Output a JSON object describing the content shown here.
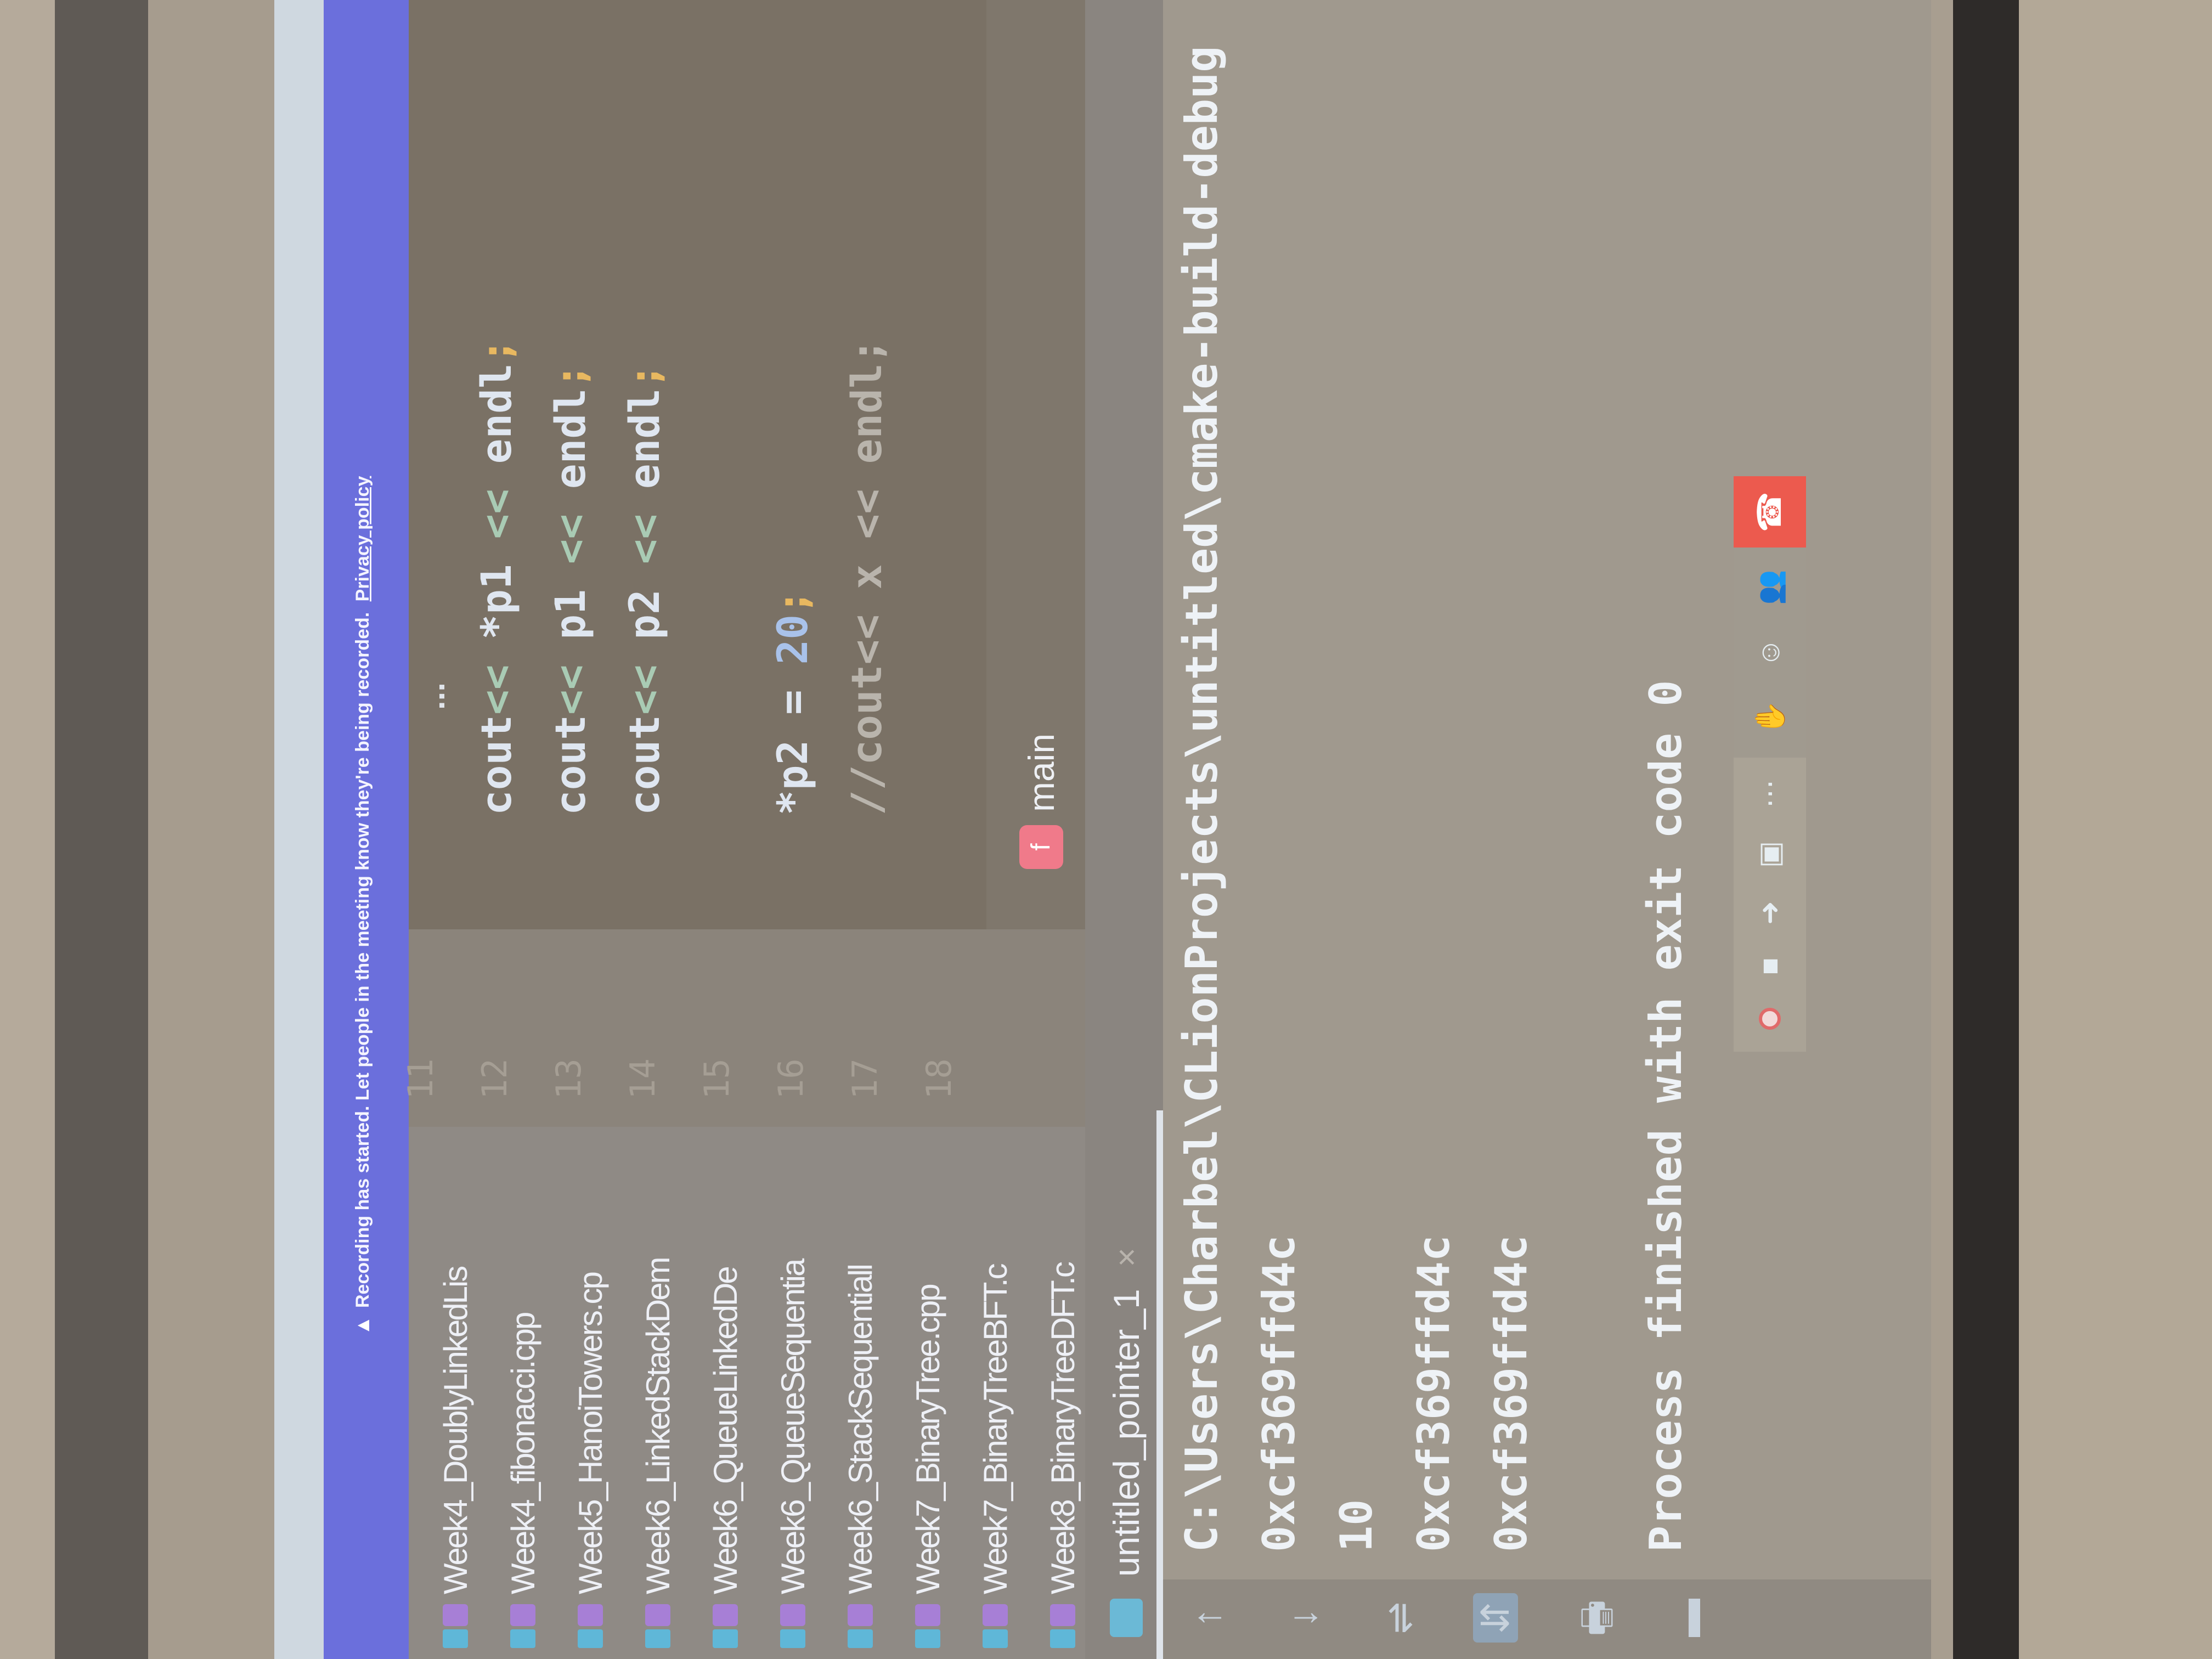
{
  "banner": {
    "icon": "warning-icon",
    "text": "Recording has started. Let people in the meeting know they're being recorded.",
    "link": "Privacy policy"
  },
  "project_files": [
    "Week4_DoublyLinkedLis",
    "Week4_fibonacci.cpp",
    "Week5_HanoiTowers.cp",
    "Week6_LinkedStackDem",
    "Week6_QueueLinkedDe",
    "Week6_QueueSequentia",
    "Week6_StackSequentiall",
    "Week7_BinaryTree.cpp",
    "Week7_BinaryTreeBFT.c",
    "Week8_BinaryTreeDFT.c"
  ],
  "editor": {
    "fold_marker": "...",
    "line_numbers": [
      "11",
      "12",
      "13",
      "14",
      "15",
      "16",
      "17",
      "18"
    ],
    "lines": [
      [],
      [
        {
          "t": "cout",
          "c": "#dfe6f0"
        },
        {
          "t": "<< ",
          "c": "#a9cbb4"
        },
        {
          "t": "*p1 ",
          "c": "#dfe6f0"
        },
        {
          "t": "<< ",
          "c": "#a9cbb4"
        },
        {
          "t": "endl",
          "c": "#dfe6f0"
        },
        {
          "t": ";",
          "c": "#e8b860"
        }
      ],
      [
        {
          "t": "cout",
          "c": "#dfe6f0"
        },
        {
          "t": "<< ",
          "c": "#a9cbb4"
        },
        {
          "t": "p1 ",
          "c": "#dfe6f0"
        },
        {
          "t": "<< ",
          "c": "#a9cbb4"
        },
        {
          "t": "endl",
          "c": "#dfe6f0"
        },
        {
          "t": ";",
          "c": "#e8b860"
        }
      ],
      [
        {
          "t": "cout",
          "c": "#dfe6f0"
        },
        {
          "t": "<< ",
          "c": "#a9cbb4"
        },
        {
          "t": "p2 ",
          "c": "#dfe6f0"
        },
        {
          "t": "<< ",
          "c": "#a9cbb4"
        },
        {
          "t": "endl",
          "c": "#dfe6f0"
        },
        {
          "t": ";",
          "c": "#e8b860"
        }
      ],
      [],
      [
        {
          "t": "*p2 = ",
          "c": "#dfe6f0"
        },
        {
          "t": "20",
          "c": "#a9c2ea"
        },
        {
          "t": ";",
          "c": "#e8b860"
        }
      ],
      [
        {
          "t": "//cout<< x << endl;",
          "c": "#b9b4ac"
        }
      ],
      []
    ],
    "breadcrumb_badge": "f",
    "breadcrumb": "main"
  },
  "run": {
    "tab_label": "untitled_pointer_1",
    "close": "×",
    "output": [
      "C:\\Users\\Charbel\\CLionProjects\\untitled\\cmake-build-debug",
      "0xcf369ffd4c",
      "10",
      "0xcf369ffd4c",
      "0xcf369ffd4c",
      "",
      "Process finished with exit code 0"
    ],
    "side_icons": [
      "↑",
      "↓",
      "⇌",
      "⇵",
      "🖶",
      "▬"
    ]
  },
  "colors": {
    "banner": "#6b6fdc",
    "leave": "#ec5a4e",
    "accent_badge": "#f07a8a"
  }
}
